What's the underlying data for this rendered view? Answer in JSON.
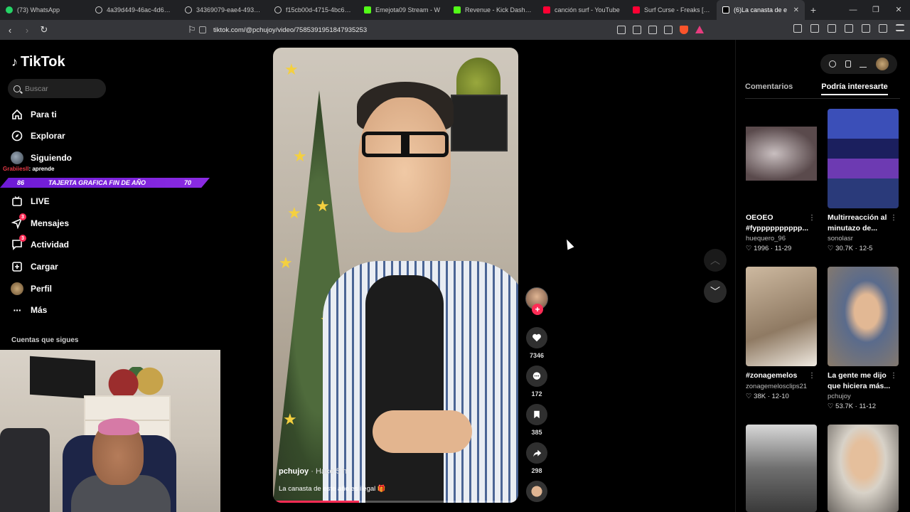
{
  "browser": {
    "tabs": [
      {
        "title": "(73) WhatsApp",
        "color": "#25d366"
      },
      {
        "title": "4a39d449-46ac-4d6b-bb7",
        "color": "#cccccc"
      },
      {
        "title": "34369079-eae4-4933-add",
        "color": "#cccccc"
      },
      {
        "title": "f15cb00d-4715-4bc6-a584",
        "color": "#cccccc"
      },
      {
        "title": "Emejota09 Stream - W",
        "color": "#53fc18"
      },
      {
        "title": "Revenue - Kick Dashboard",
        "color": "#53fc18"
      },
      {
        "title": "canción surf - YouTube",
        "color": "#ff0033"
      },
      {
        "title": "Surf Curse - Freaks [Offici",
        "color": "#ff0033"
      },
      {
        "title": "(6)La canasta de e",
        "color": "#ffffff",
        "active": true
      }
    ],
    "url": "tiktok.com/@pchujoy/video/7585391951847935253"
  },
  "sidebar": {
    "logo": "TikTok",
    "search_placeholder": "Buscar",
    "items": [
      {
        "label": "Para ti",
        "icon": "home-icon"
      },
      {
        "label": "Explorar",
        "icon": "compass-icon"
      },
      {
        "label": "Siguiendo",
        "icon": "following-avatar"
      },
      {
        "label": "LIVE",
        "icon": "live-icon"
      },
      {
        "label": "Mensajes",
        "icon": "message-icon",
        "badge": "3"
      },
      {
        "label": "Actividad",
        "icon": "activity-icon",
        "badge": "3"
      },
      {
        "label": "Cargar",
        "icon": "upload-icon"
      },
      {
        "label": "Perfil",
        "icon": "profile-avatar"
      },
      {
        "label": "Más",
        "icon": "more-icon"
      }
    ],
    "following_title": "Cuentas que sigues"
  },
  "stream_overlay": {
    "chat_user": "Grabiiesll",
    "chat_message": ": aprende",
    "goal_current": "86",
    "goal_text": "TAJERTA GRAFICA FIN DE AÑO",
    "goal_target": "70"
  },
  "video": {
    "username": "pchujoy",
    "time": "· Hace 5 h",
    "caption": "La canasta de este año es ilegal 🎁",
    "progress": 0.35
  },
  "actions": {
    "likes": "7346",
    "comments": "172",
    "saves": "385",
    "shares": "298"
  },
  "right_panel": {
    "tab_comments": "Comentarios",
    "tab_suggested": "Podría interesarte",
    "cards": [
      {
        "title": "OEOEO #fypppppppppp...",
        "user": "huequero_96",
        "likes": "1996",
        "date": "11-29"
      },
      {
        "title": "Multirreacción al minutazo de...",
        "user": "sonolasr",
        "likes": "30.7K",
        "date": "12-5"
      },
      {
        "title": "#zonagemelos",
        "user": "zonagemelosclips21",
        "likes": "38K",
        "date": "12-10"
      },
      {
        "title": "La gente me dijo que hiciera más...",
        "user": "pchujoy",
        "likes": "53.7K",
        "date": "11-12"
      },
      {
        "title": "",
        "user": "",
        "likes": "",
        "date": ""
      },
      {
        "title": "",
        "user": "",
        "likes": "",
        "date": ""
      }
    ]
  },
  "colors": {
    "accent": "#fe2c55",
    "goal_bar": "#7b22dd"
  }
}
